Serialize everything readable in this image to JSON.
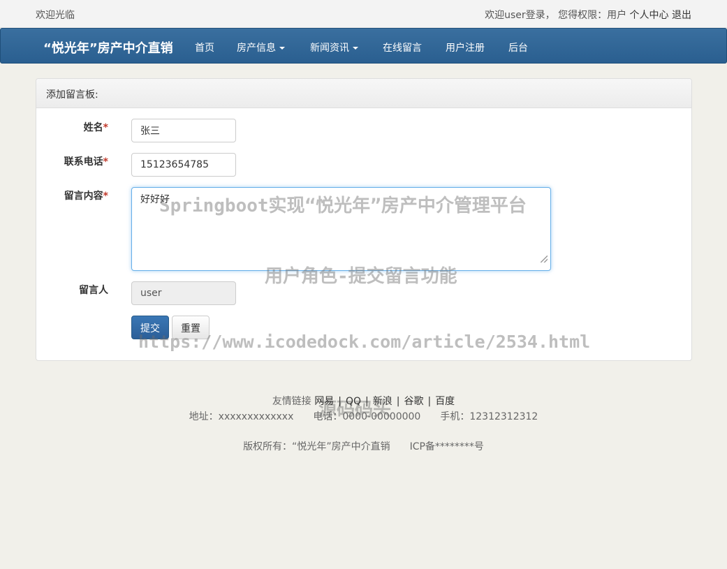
{
  "topbar": {
    "welcome": "欢迎光临",
    "login_info": "欢迎user登录，  您得权限：用户",
    "profile": "个人中心",
    "logout": "退出"
  },
  "navbar": {
    "brand": "“悦光年”房产中介直销",
    "items": [
      "首页",
      "房产信息",
      "新闻资讯",
      "在线留言",
      "用户注册",
      "后台"
    ]
  },
  "panel": {
    "title": "添加留言板:",
    "fields": {
      "name_label": "姓名",
      "name_value": "张三",
      "phone_label": "联系电话",
      "phone_value": "15123654785",
      "content_label": "留言内容",
      "content_value": "好好好",
      "author_label": "留言人",
      "author_value": "user",
      "required_mark": "*"
    },
    "submit": "提交",
    "reset": "重置"
  },
  "watermarks": [
    "Springboot实现“悦光年”房产中介管理平台",
    "用户角色-提交留言功能",
    "https://www.icodedock.com/article/2534.html",
    "源码码头"
  ],
  "footer": {
    "links_label": "友情链接",
    "links": [
      "网易",
      "QQ",
      "新浪",
      "谷歌",
      "百度"
    ],
    "address": "地址：xxxxxxxxxxxxx",
    "phone": "电话：0000-00000000",
    "mobile": "手机：12312312312",
    "copyright": "版权所有：“悦光年”房产中介直销",
    "icp": "ICP备********号"
  }
}
